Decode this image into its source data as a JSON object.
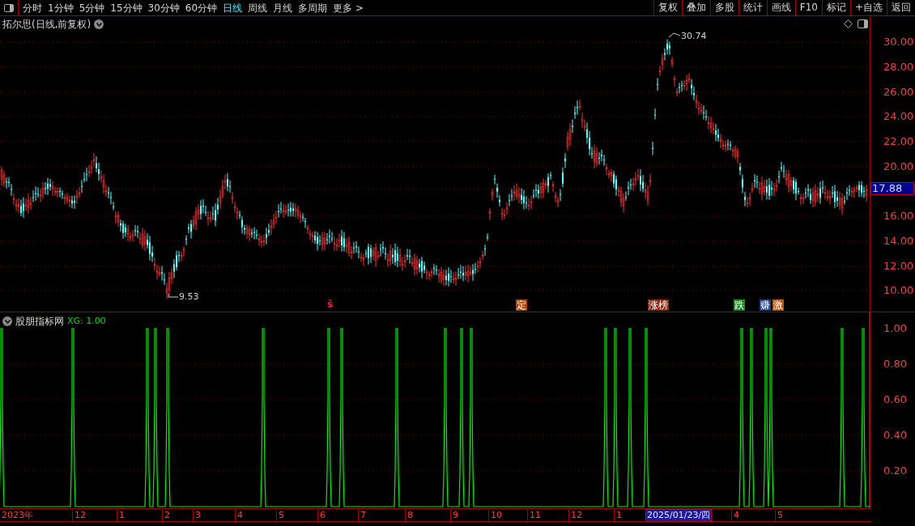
{
  "toolbar": {
    "periods": [
      {
        "label": "分时",
        "selected": false
      },
      {
        "label": "1分钟",
        "selected": false
      },
      {
        "label": "5分钟",
        "selected": false
      },
      {
        "label": "15分钟",
        "selected": false
      },
      {
        "label": "30分钟",
        "selected": false
      },
      {
        "label": "60分钟",
        "selected": false
      },
      {
        "label": "日线",
        "selected": true
      },
      {
        "label": "周线",
        "selected": false
      },
      {
        "label": "月线",
        "selected": false
      },
      {
        "label": "多周期",
        "selected": false
      },
      {
        "label": "更多 >",
        "selected": false
      }
    ],
    "actions": [
      "复权",
      "叠加",
      "多股",
      "统计",
      "画线",
      "F10",
      "标记",
      "+自选",
      "返回"
    ]
  },
  "main_chart": {
    "title": "拓尔思(日线,前复权)",
    "high_label": "30.74",
    "low_label": "9.53",
    "last_price": "17.88",
    "y_ticks": [
      "30.00",
      "28.00",
      "26.00",
      "24.00",
      "22.00",
      "20.00",
      "16.00",
      "14.00",
      "12.00",
      "10.00"
    ]
  },
  "event_markers": [
    {
      "label": "ŝ",
      "kind": "text",
      "color": "#ff2020"
    },
    {
      "label": "定",
      "kind": "badge",
      "color": "#b0450a"
    },
    {
      "label": "涨榜",
      "kind": "badge",
      "color": "#8a2a10"
    },
    {
      "label": "跌",
      "kind": "badge",
      "color": "#1d8a1d"
    },
    {
      "label": "赚",
      "kind": "badge",
      "color": "#1c3a80"
    },
    {
      "label": "激",
      "kind": "badge",
      "color": "#c0560e"
    }
  ],
  "indicator": {
    "title": "股朋指标网",
    "value_label": "XG: 1.00",
    "y_ticks": [
      "1.00",
      "0.80",
      "0.60",
      "0.40",
      "0.20"
    ]
  },
  "time_axis": {
    "labels": [
      "2023年",
      "12",
      "1",
      "2",
      "3",
      "4",
      "5",
      "6",
      "7",
      "8",
      "9",
      "10",
      "11",
      "12",
      "1",
      "4",
      "5"
    ],
    "cursor_date": "2025/01/23/四"
  }
}
